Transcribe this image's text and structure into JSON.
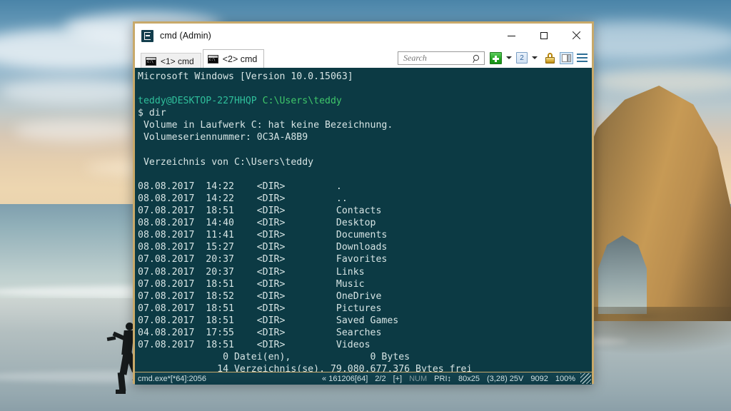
{
  "window": {
    "title": "cmd (Admin)",
    "app_icon": "conemu-icon",
    "controls": {
      "minimize": "minimize",
      "maximize": "maximize",
      "close": "close"
    },
    "border_color": "#c8a96a"
  },
  "tabs": [
    {
      "label": "<1> cmd",
      "active": false,
      "icon": "console-icon"
    },
    {
      "label": "<2> cmd",
      "active": true,
      "icon": "console-icon"
    }
  ],
  "toolbar": {
    "search_placeholder": "Search",
    "search_value": "",
    "search_icon": "magnifier-icon",
    "new_console_icon": "green-plus-icon",
    "new_console_caret": "chevron-down-icon",
    "active_console_label": "2",
    "active_console_caret": "chevron-down-icon",
    "lock_icon": "padlock-icon",
    "panels_icon": "split-panel-icon",
    "menu_icon": "hamburger-menu-icon"
  },
  "console": {
    "background": "#0c3a44",
    "user_host": "teddy@DESKTOP-227HHQP",
    "cwd": "C:\\Users\\teddy",
    "command": "$ dir",
    "banner": "Microsoft Windows [Version 10.0.15063]",
    "volume_line": " Volume in Laufwerk C: hat keine Bezeichnung.",
    "serial_line": " Volumeseriennummer: 0C3A-A8B9",
    "dir_header": " Verzeichnis von C:\\Users\\teddy",
    "entries": [
      {
        "date": "08.08.2017",
        "time": "14:22",
        "type": "<DIR>",
        "name": "."
      },
      {
        "date": "08.08.2017",
        "time": "14:22",
        "type": "<DIR>",
        "name": ".."
      },
      {
        "date": "07.08.2017",
        "time": "18:51",
        "type": "<DIR>",
        "name": "Contacts"
      },
      {
        "date": "08.08.2017",
        "time": "14:40",
        "type": "<DIR>",
        "name": "Desktop"
      },
      {
        "date": "08.08.2017",
        "time": "11:41",
        "type": "<DIR>",
        "name": "Documents"
      },
      {
        "date": "08.08.2017",
        "time": "15:27",
        "type": "<DIR>",
        "name": "Downloads"
      },
      {
        "date": "07.08.2017",
        "time": "20:37",
        "type": "<DIR>",
        "name": "Favorites"
      },
      {
        "date": "07.08.2017",
        "time": "20:37",
        "type": "<DIR>",
        "name": "Links"
      },
      {
        "date": "07.08.2017",
        "time": "18:51",
        "type": "<DIR>",
        "name": "Music"
      },
      {
        "date": "07.08.2017",
        "time": "18:52",
        "type": "<DIR>",
        "name": "OneDrive"
      },
      {
        "date": "07.08.2017",
        "time": "18:51",
        "type": "<DIR>",
        "name": "Pictures"
      },
      {
        "date": "07.08.2017",
        "time": "18:51",
        "type": "<DIR>",
        "name": "Saved Games"
      },
      {
        "date": "04.08.2017",
        "time": "17:55",
        "type": "<DIR>",
        "name": "Searches"
      },
      {
        "date": "07.08.2017",
        "time": "18:51",
        "type": "<DIR>",
        "name": "Videos"
      }
    ],
    "files_summary": "               0 Datei(en),              0 Bytes",
    "dirs_summary": "              14 Verzeichnis(se), 79.080.677.376 Bytes frei"
  },
  "statusbar": {
    "process": "cmd.exe*[*64]:2056",
    "scroll": "« 161206[64]",
    "tab_index": "2/2",
    "insert": "[+]",
    "num": "NUM",
    "pri": "PRI↕",
    "size": "80x25",
    "cursor": "(3,28) 25V",
    "handle": "9092",
    "zoom": "100%"
  }
}
